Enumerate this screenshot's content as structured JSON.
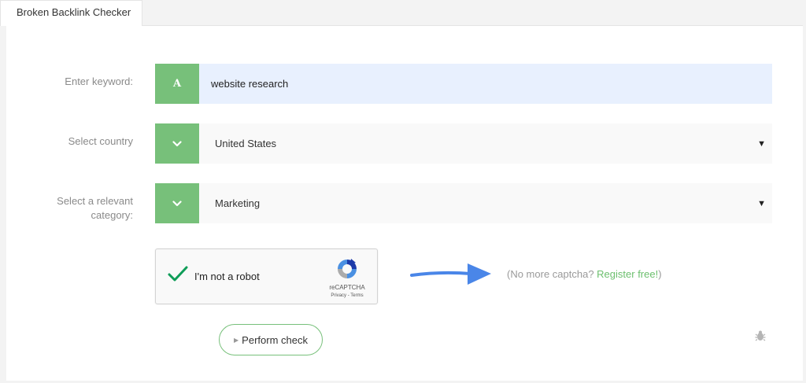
{
  "tab": {
    "label": "Broken Backlink Checker"
  },
  "form": {
    "keyword": {
      "label": "Enter keyword:",
      "addon": "A",
      "value": "website research"
    },
    "country": {
      "label": "Select country",
      "value": "United States"
    },
    "category": {
      "label_line1": "Select a relevant",
      "label_line2": "category:",
      "value": "Marketing"
    }
  },
  "captcha": {
    "label": "I'm not a robot",
    "brand": "reCAPTCHA",
    "privacy": "Privacy",
    "separator": " - ",
    "terms": "Terms",
    "checked": true
  },
  "promo": {
    "text": "(No more captcha? ",
    "link": "Register free!",
    "close": ")"
  },
  "actions": {
    "perform_check": "Perform check"
  },
  "icons": {
    "chevron": "chevron-down-icon",
    "dropdown": "caret-down-icon",
    "bug": "bug-icon",
    "arrow": "arrow-right-icon"
  },
  "colors": {
    "accent": "#77c07a",
    "link": "#6cbf6e",
    "keyword_bg": "#e8f0fe",
    "arrow": "#4a86e8"
  }
}
